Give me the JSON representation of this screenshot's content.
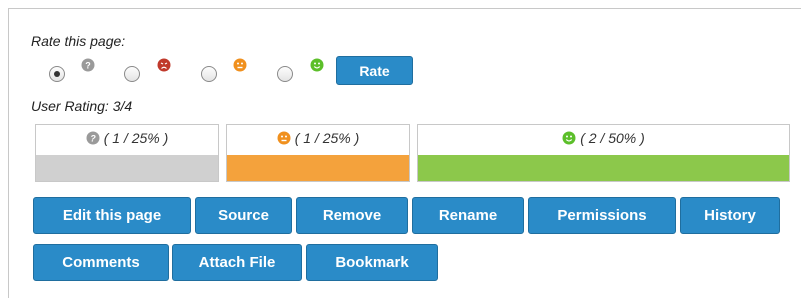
{
  "rate": {
    "title": "Rate this page:",
    "options": [
      {
        "icon": "question-face-icon",
        "color": "#9a9a9a",
        "checked": true
      },
      {
        "icon": "angry-face-icon",
        "color": "#c0392b",
        "checked": false
      },
      {
        "icon": "neutral-face-icon",
        "color": "#f0901e",
        "checked": false
      },
      {
        "icon": "smiley-face-icon",
        "color": "#5cbf2a",
        "checked": false
      }
    ],
    "button_label": "Rate"
  },
  "user_rating": {
    "label": "User Rating: 3/4",
    "bars": [
      {
        "label": "( 1 / 25% )",
        "icon": "question-face-icon",
        "color": "#d0d0d0",
        "fraction": 0.25
      },
      {
        "label": "( 1 / 25% )",
        "icon": "neutral-face-icon",
        "color": "#f4a23c",
        "fraction": 0.25
      },
      {
        "label": "( 2 / 50% )",
        "icon": "smiley-face-icon",
        "color": "#8cc84b",
        "fraction": 0.5
      }
    ]
  },
  "actions": {
    "edit": "Edit this page",
    "source": "Source",
    "remove": "Remove",
    "rename": "Rename",
    "permissions": "Permissions",
    "history": "History",
    "comments": "Comments",
    "attach": "Attach File",
    "bookmark": "Bookmark"
  },
  "colors": {
    "button": "#2a8bc8"
  }
}
